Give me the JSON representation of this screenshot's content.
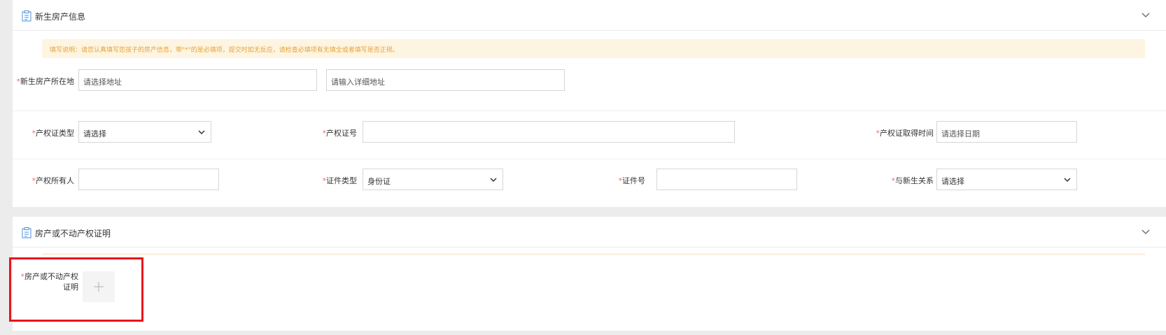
{
  "panel1": {
    "title": "新生房产信息",
    "notice": "填写说明：请您认真填写您孩子的房产信息，带\"*\"的是必填项，提交时如无反应，请检查必填项有无填全或者填写是否正规。",
    "address": {
      "required_mark": "*",
      "label": "新生房产所在地",
      "region_placeholder": "请选择地址",
      "detail_placeholder": "请输入详细地址"
    },
    "cert_type": {
      "required_mark": "*",
      "label": "产权证类型",
      "value": "请选择"
    },
    "cert_no": {
      "required_mark": "*",
      "label": "产权证号",
      "value": ""
    },
    "cert_date": {
      "required_mark": "*",
      "label": "产权证取得时间",
      "placeholder": "请选择日期"
    },
    "owner": {
      "required_mark": "*",
      "label": "产权所有人",
      "value": ""
    },
    "id_type": {
      "required_mark": "*",
      "label": "证件类型",
      "value": "身份证"
    },
    "id_no": {
      "required_mark": "*",
      "label": "证件号",
      "value": ""
    },
    "relation": {
      "required_mark": "*",
      "label": "与新生关系",
      "value": "请选择"
    }
  },
  "panel2": {
    "title": "房产或不动产权证明",
    "upload": {
      "required_mark": "*",
      "label_line1": "房产或不动产权",
      "label_line2": "证明",
      "plus": "+"
    }
  },
  "colors": {
    "required": "#f56c6c",
    "notice_text": "#e6a23c",
    "notice_bg": "#fdf5e1",
    "highlight_border": "#e8141b",
    "icon_blue": "#4a90e2"
  }
}
